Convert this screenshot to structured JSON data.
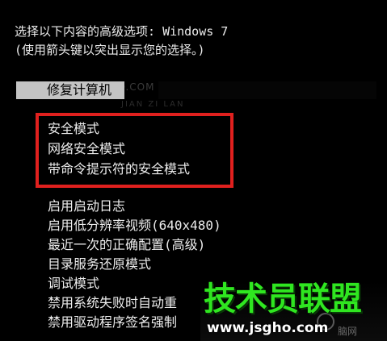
{
  "header": {
    "line1": "选择以下内容的高级选项: Windows 7",
    "line2": "(使用箭头键以突出显示您的选择。)"
  },
  "menu": {
    "selected_label": "修复计算机",
    "safe_modes": [
      "安全模式",
      "网络安全模式",
      "带命令提示符的安全模式"
    ],
    "other_options": [
      "启用启动日志",
      "启用低分辨率视频(640x480)",
      "最近一次的正确配置(高级)",
      "目录服务还原模式",
      "调试模式",
      "禁用系统失败时自动重",
      "禁用驱动程序签名强制"
    ]
  },
  "watermark": {
    "text1": "JSGHO.COM",
    "text2": "JIAN ZI LAN"
  },
  "brand": {
    "title": "技术员联盟",
    "url": "www.jsgho.com",
    "faint": "脑网"
  },
  "colors": {
    "background": "#000000",
    "text": "#ececec",
    "selected_bar": "#c4c4c4",
    "highlight_border": "#e0201e",
    "brand_green": "#2fe620"
  }
}
